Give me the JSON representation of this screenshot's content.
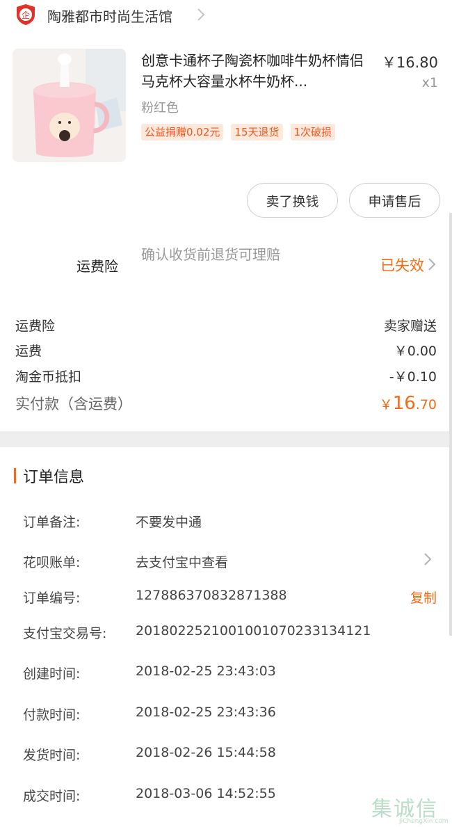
{
  "shop": {
    "name": "陶雅都市时尚生活馆",
    "logo_icon": "shop-badge-icon"
  },
  "product": {
    "title": "创意卡通杯子陶瓷杯咖啡牛奶杯情侣马克杯大容量水杯牛奶杯...",
    "price": "￥16.80",
    "quantity": "x1",
    "variant": "粉红色",
    "tags": [
      "公益捐赠0.02元",
      "15天退货",
      "1次破损"
    ]
  },
  "actions": {
    "sell": "卖了换钱",
    "after_sale": "申请售后"
  },
  "insurance": {
    "label": "运费险",
    "desc": "确认收货前退货可理赔",
    "status": "已失效"
  },
  "fees": [
    {
      "label": "运费险",
      "value": "卖家赠送"
    },
    {
      "label": "运费",
      "value": "￥0.00"
    },
    {
      "label": "淘金币抵扣",
      "value": "-￥0.10"
    }
  ],
  "total": {
    "label": "实付款（含运费）",
    "currency": "￥",
    "integer": "16",
    "decimal": ".70"
  },
  "order_info": {
    "title": "订单信息",
    "rows": [
      {
        "key": "订单备注:",
        "value": "不要发中通"
      },
      {
        "key": "花呗账单:",
        "value": "去支付宝中查看"
      },
      {
        "key": "订单编号:",
        "value": "127886370832871388",
        "action": "复制"
      },
      {
        "key": "支付宝交易号:",
        "value": "2018022521001001070233134121"
      },
      {
        "key": "创建时间:",
        "value": "2018-02-25 23:43:03"
      },
      {
        "key": "付款时间:",
        "value": "2018-02-25 23:43:36"
      },
      {
        "key": "发货时间:",
        "value": "2018-02-26 15:44:58"
      },
      {
        "key": "成交时间:",
        "value": "2018-03-06 14:52:55"
      }
    ]
  },
  "watermark": {
    "cn": "集诚信",
    "en": "JiChengXin.com"
  },
  "colors": {
    "accent": "#f26b12",
    "tag_bg": "#fde8dc",
    "tag_text": "#f2561d"
  }
}
